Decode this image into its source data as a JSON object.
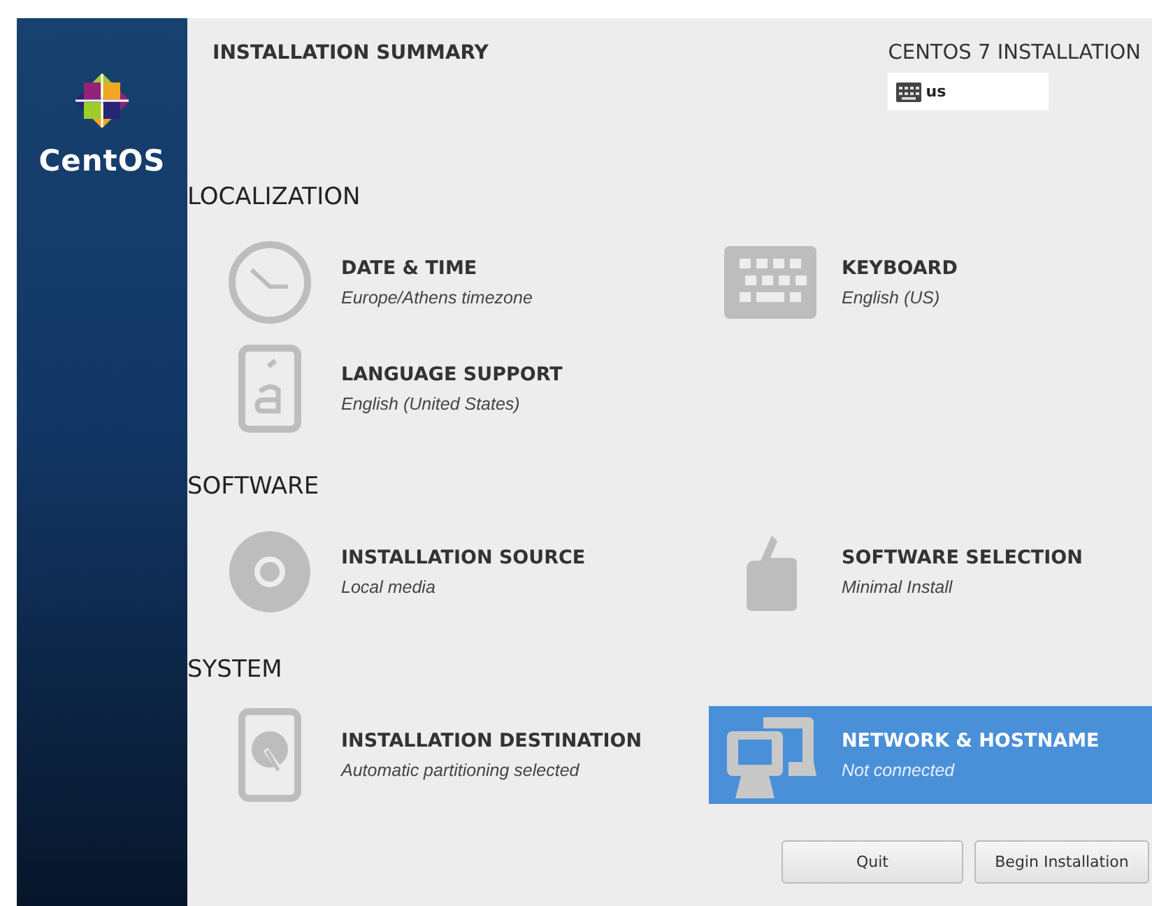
{
  "sidebar": {
    "logo_text": "CentOS"
  },
  "header": {
    "title": "INSTALLATION SUMMARY",
    "product": "CENTOS 7 INSTALLATION",
    "keyboard_layout": "us"
  },
  "sections": [
    {
      "title": "LOCALIZATION",
      "spokes": [
        {
          "kind": "clock",
          "title": "DATE & TIME",
          "status": "Europe/Athens timezone",
          "selected": false
        },
        {
          "kind": "keyboard",
          "title": "KEYBOARD",
          "status": "English (US)",
          "selected": false
        },
        {
          "kind": "language",
          "title": "LANGUAGE SUPPORT",
          "status": "English (United States)",
          "selected": false
        }
      ]
    },
    {
      "title": "SOFTWARE",
      "spokes": [
        {
          "kind": "disc",
          "title": "INSTALLATION SOURCE",
          "status": "Local media",
          "selected": false
        },
        {
          "kind": "package",
          "title": "SOFTWARE SELECTION",
          "status": "Minimal Install",
          "selected": false
        }
      ]
    },
    {
      "title": "SYSTEM",
      "spokes": [
        {
          "kind": "disk",
          "title": "INSTALLATION DESTINATION",
          "status": "Automatic partitioning selected",
          "selected": false
        },
        {
          "kind": "network",
          "title": "NETWORK & HOSTNAME",
          "status": "Not connected",
          "selected": true
        }
      ]
    }
  ],
  "buttons": [
    "Quit",
    "Begin Installation"
  ]
}
